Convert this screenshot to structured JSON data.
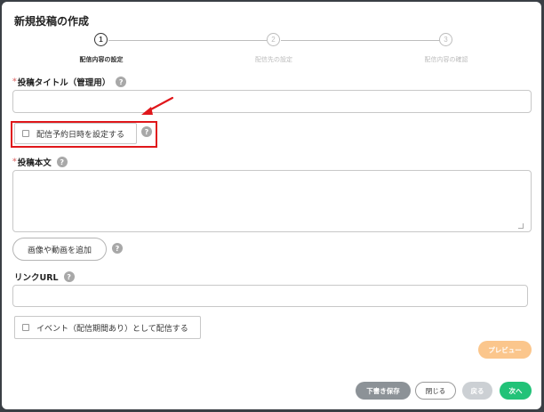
{
  "dialog": {
    "title": "新規投稿の作成"
  },
  "steps": [
    {
      "number": "1",
      "label": "配信内容の設定"
    },
    {
      "number": "2",
      "label": "配信先の設定"
    },
    {
      "number": "3",
      "label": "配信内容の確認"
    }
  ],
  "form": {
    "required_mark": "*",
    "help_symbol": "?",
    "title_label": "投稿タイトル（管理用）",
    "title_value": "",
    "schedule_checkbox_label": "配信予約日時を設定する",
    "body_label": "投稿本文",
    "body_value": "",
    "add_media_label": "画像や動画を追加",
    "link_label": "リンクURL",
    "link_value": "",
    "event_checkbox_label": "イベント（配信期間あり）として配信する"
  },
  "buttons": {
    "preview": "プレビュー",
    "draft": "下書き保存",
    "close": "閉じる",
    "back": "戻る",
    "next": "次へ"
  },
  "colors": {
    "annotation_red": "#e0171b",
    "preview_orange": "#fbc68c",
    "next_green": "#22c278",
    "draft_gray": "#8c9297"
  }
}
